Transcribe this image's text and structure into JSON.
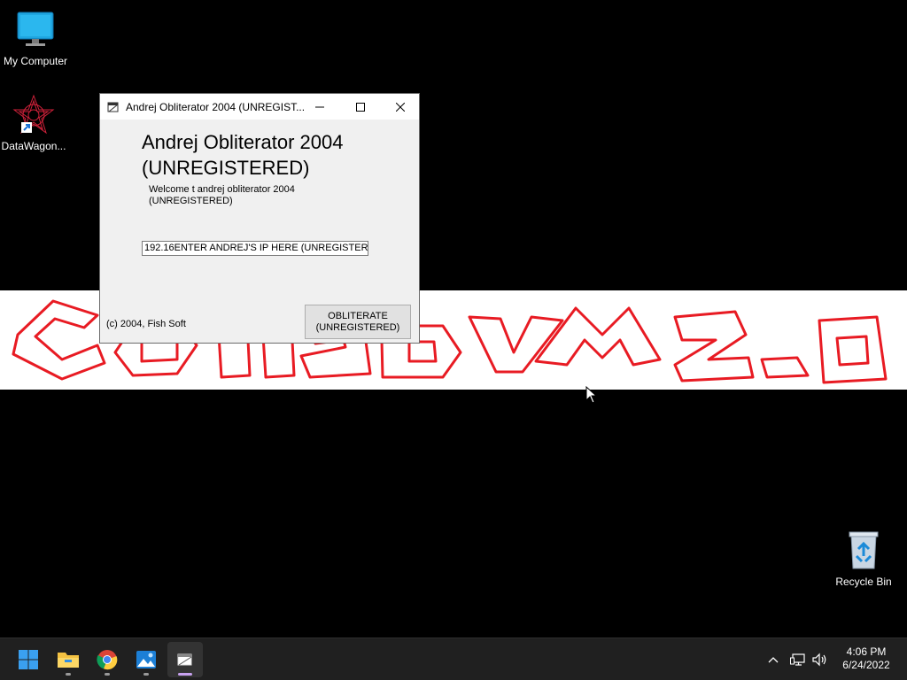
{
  "desktop": {
    "icons": [
      {
        "label": "My Computer",
        "icon": "monitor-icon"
      },
      {
        "label": "DataWagon...",
        "icon": "datawagon-icon"
      },
      {
        "label": "Recycle Bin",
        "icon": "recycle-bin-icon"
      }
    ],
    "banner_text": "CollabVM 2.0",
    "banner_color": "#e81b23"
  },
  "window": {
    "title": "Andrej Obliterator 2004 (UNREGIST...",
    "heading_line1": "Andrej Obliterator 2004",
    "heading_line2": "(UNREGISTERED)",
    "welcome_line1": "Welcome t andrej obliterator 2004",
    "welcome_line2": "(UNREGISTERED)",
    "ip_value": "192.16ENTER ANDREJ'S IP HERE (UNREGISTERED)",
    "copyright": "(c) 2004, Fish Soft",
    "button_line1": "OBLITERATE",
    "button_line2": "(UNREGISTERED)"
  },
  "taskbar": {
    "apps": [
      {
        "name": "start",
        "icon": "windows-start-icon"
      },
      {
        "name": "file-explorer",
        "icon": "folder-icon"
      },
      {
        "name": "chrome",
        "icon": "chrome-icon"
      },
      {
        "name": "photos",
        "icon": "photos-icon"
      },
      {
        "name": "obliterator",
        "icon": "app-window-icon",
        "active": true
      }
    ],
    "clock_time": "4:06 PM",
    "clock_date": "6/24/2022"
  }
}
